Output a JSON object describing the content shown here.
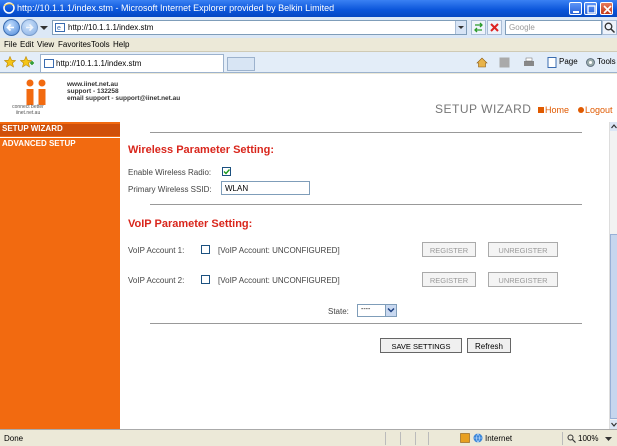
{
  "browser": {
    "window_title": "http://10.1.1.1/index.stm - Microsoft Internet Explorer provided by Belkin Limited",
    "address": "http://10.1.1.1/index.stm",
    "search_placeholder": "Google",
    "menu": [
      "File",
      "Edit",
      "View",
      "Favorites",
      "Tools",
      "Help"
    ],
    "tab_label": "http://10.1.1.1/index.stm",
    "command_page": "Page",
    "command_tools": "Tools",
    "status_text": "Done",
    "zone": "Internet",
    "zoom": "100%"
  },
  "header": {
    "logo_text_1": "connect better",
    "logo_text_2": "iinet.net.au",
    "contact_web": "www.iinet.net.au",
    "contact_phone": "support - 132258",
    "contact_email": "email support - support@iinet.net.au",
    "title": "SETUP WIZARD",
    "home_link": "Home",
    "logout_link": "Logout"
  },
  "sidebar": {
    "items": [
      {
        "label": "SETUP WIZARD"
      },
      {
        "label": "ADVANCED SETUP"
      }
    ]
  },
  "wireless": {
    "title": "Wireless Parameter Setting:",
    "enable_label": "Enable Wireless Radio:",
    "enable_checked": true,
    "ssid_label": "Primary Wireless SSID:",
    "ssid_value": "WLAN"
  },
  "voip": {
    "title": "VoIP Parameter Setting:",
    "accounts": [
      {
        "label": "VoIP Account 1:",
        "status": "[VoIP Account: UNCONFIGURED]",
        "register": "REGISTER",
        "unregister": "UNREGISTER"
      },
      {
        "label": "VoIP Account 2:",
        "status": "[VoIP Account: UNCONFIGURED]",
        "register": "REGISTER",
        "unregister": "UNREGISTER"
      }
    ],
    "state_label": "State:",
    "state_value": "----"
  },
  "actions": {
    "save": "SAVE SETTINGS",
    "refresh": "Refresh"
  },
  "colors": {
    "accent_orange": "#f26a10",
    "section_red": "#d9261c",
    "titlebar_blue": "#0a54d9"
  }
}
